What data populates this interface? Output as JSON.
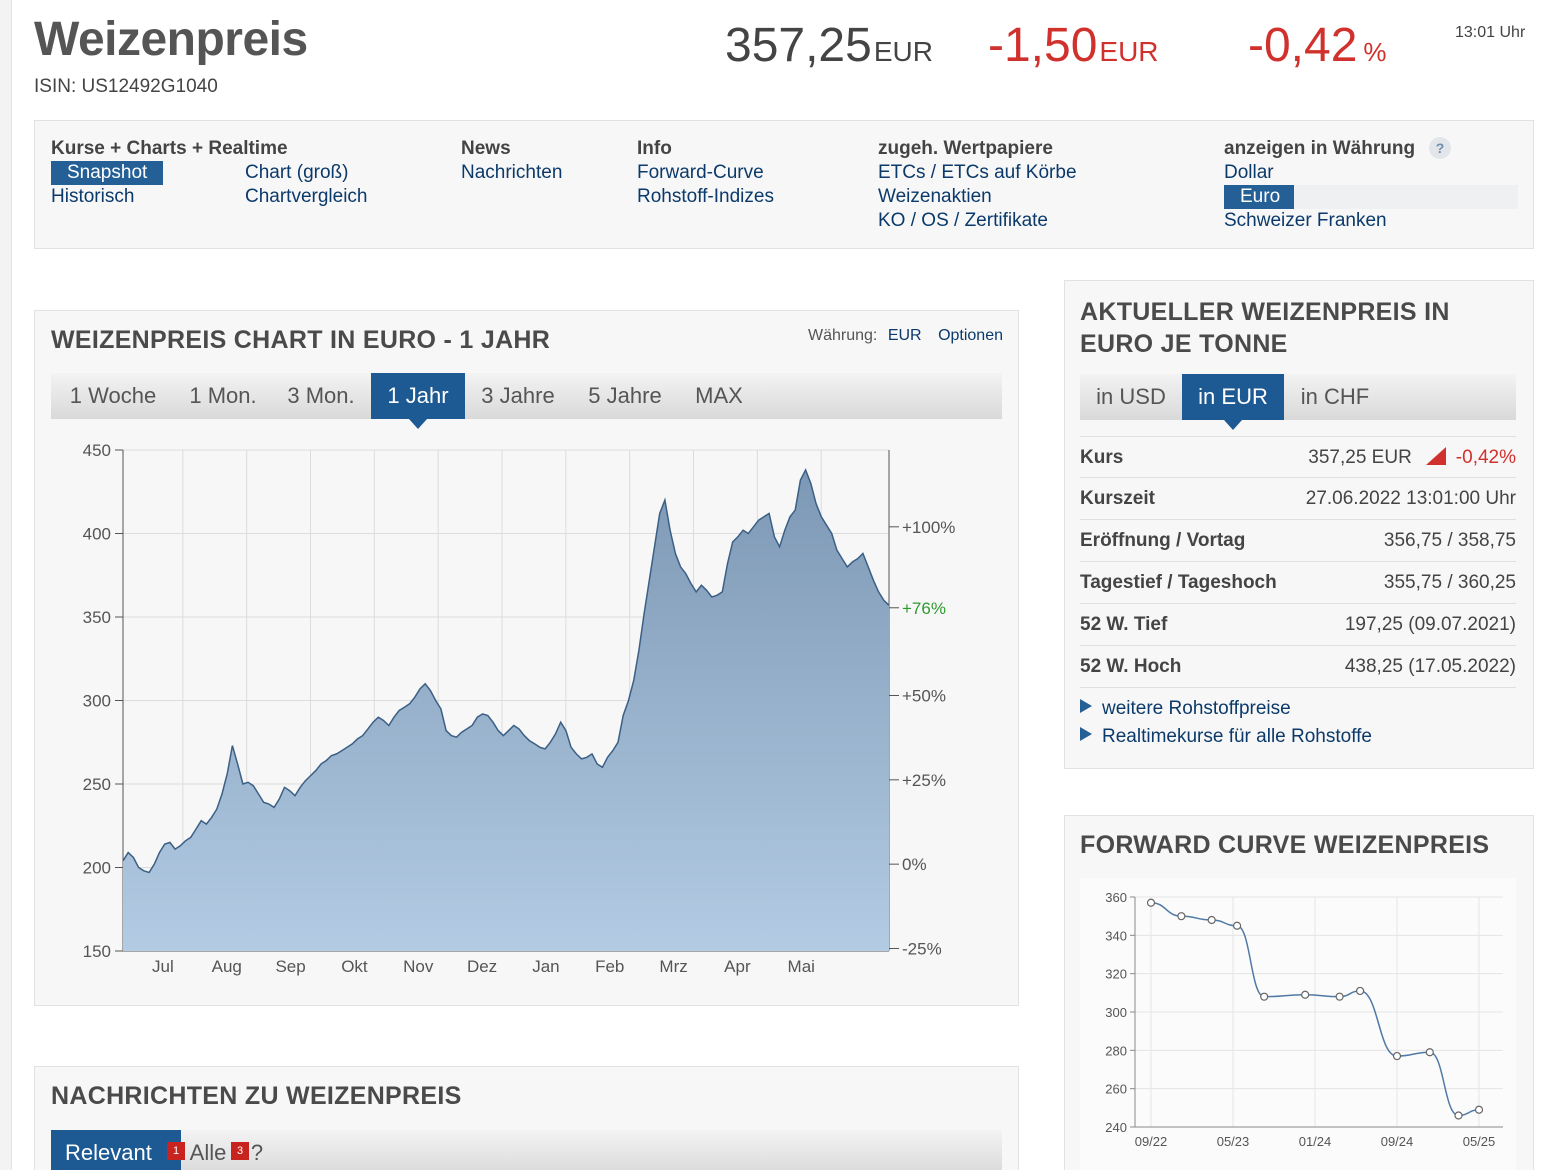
{
  "header": {
    "title": "Weizenpreis",
    "isin": "ISIN: US12492G1040",
    "price": "357,25",
    "price_unit": "EUR",
    "change": "-1,50",
    "change_unit": "EUR",
    "change_pct": "-0,42",
    "pct_unit": "%",
    "time": "13:01 Uhr"
  },
  "nav": {
    "col1": {
      "heading": "Kurse + Charts + Realtime",
      "items": [
        "Snapshot",
        "Historisch"
      ]
    },
    "col1b": {
      "items": [
        "Chart (groß)",
        "Chartvergleich"
      ]
    },
    "col2": {
      "heading": "News",
      "items": [
        "Nachrichten"
      ]
    },
    "col3": {
      "heading": "Info",
      "items": [
        "Forward-Curve",
        "Rohstoff-Indizes"
      ]
    },
    "col4": {
      "heading": "zugeh. Wertpapiere",
      "items": [
        "ETCs / ETCs auf Körbe",
        "Weizenaktien",
        "KO / OS / Zertifikate"
      ]
    },
    "col5": {
      "heading": "anzeigen in Währung",
      "help": "?",
      "items": [
        "Dollar",
        "Euro",
        "Schweizer Franken"
      ]
    }
  },
  "main_chart": {
    "title": "WEIZENPREIS CHART IN EURO - 1 JAHR",
    "currency_label": "Währung:",
    "currency_value": "EUR",
    "options_label": "Optionen",
    "tabs": [
      "1 Woche",
      "1 Mon.",
      "3 Mon.",
      "1 Jahr",
      "3 Jahre",
      "5 Jahre",
      "MAX"
    ],
    "active_tab": "1 Jahr"
  },
  "quote_panel": {
    "title_line1": "AKTUELLER WEIZENPREIS IN",
    "title_line2": "EURO JE TONNE",
    "tabs": [
      "in USD",
      "in EUR",
      "in CHF"
    ],
    "active_tab": "in EUR",
    "rows": [
      {
        "label": "Kurs",
        "value": "357,25 EUR",
        "extra": "-0,42%"
      },
      {
        "label": "Kurszeit",
        "value": "27.06.2022 13:01:00 Uhr"
      },
      {
        "label": "Eröffnung / Vortag",
        "value": "356,75 / 358,75"
      },
      {
        "label": "Tagestief / Tageshoch",
        "value": "355,75 / 360,25"
      },
      {
        "label": "52 W. Tief",
        "value": "197,25 (09.07.2021)"
      },
      {
        "label": "52 W. Hoch",
        "value": "438,25 (17.05.2022)"
      }
    ],
    "links": [
      "weitere Rohstoffpreise",
      "Realtimekurse für alle Rohstoffe"
    ]
  },
  "forward_panel": {
    "title": "FORWARD CURVE WEIZENPREIS"
  },
  "news_panel": {
    "title": "NACHRICHTEN ZU WEIZENPREIS",
    "tabs": [
      {
        "label": "Relevant",
        "count": "1"
      },
      {
        "label": "Alle",
        "count": "3"
      }
    ],
    "help": "?"
  },
  "colors": {
    "accent": "#1d5a94",
    "negative": "#d0312d",
    "positive": "#2e9a2e",
    "area_fill": "#8aa6c2",
    "line": "#3b5f85"
  },
  "chart_data": [
    {
      "type": "area",
      "x": [
        "Jul",
        "Aug",
        "Sep",
        "Okt",
        "Nov",
        "Dez",
        "Jan",
        "Feb",
        "Mrz",
        "Apr",
        "Mai"
      ],
      "y_ticks": [
        150,
        200,
        250,
        300,
        350,
        400,
        450
      ],
      "y_right_ticks": [
        "--25%",
        "-0%",
        "-+25%",
        "-+50%",
        "-+76%",
        "-+100%"
      ],
      "ylim": [
        150,
        450
      ],
      "current_pct_label": "+76%",
      "values": [
        204,
        209,
        206,
        200,
        198,
        197,
        202,
        209,
        214,
        215,
        211,
        213,
        216,
        218,
        223,
        228,
        226,
        230,
        235,
        244,
        256,
        273,
        262,
        250,
        251,
        249,
        244,
        239,
        238,
        236,
        241,
        248,
        246,
        243,
        248,
        252,
        255,
        258,
        262,
        264,
        267,
        268,
        270,
        272,
        274,
        277,
        279,
        283,
        287,
        290,
        288,
        285,
        290,
        294,
        296,
        298,
        302,
        307,
        310,
        306,
        300,
        295,
        282,
        279,
        278,
        281,
        283,
        285,
        290,
        292,
        291,
        287,
        282,
        279,
        282,
        285,
        283,
        279,
        276,
        274,
        272,
        271,
        275,
        280,
        287,
        282,
        272,
        268,
        265,
        266,
        268,
        262,
        260,
        266,
        270,
        275,
        291,
        300,
        312,
        330,
        352,
        372,
        392,
        412,
        420,
        402,
        388,
        380,
        376,
        370,
        365,
        369,
        366,
        362,
        363,
        365,
        382,
        395,
        398,
        402,
        400,
        404,
        408,
        410,
        412,
        398,
        392,
        402,
        410,
        414,
        432,
        438,
        430,
        418,
        410,
        405,
        400,
        390,
        385,
        380,
        383,
        385,
        388,
        380,
        372,
        365,
        360,
        357
      ],
      "xlabel": "",
      "ylabel": ""
    },
    {
      "type": "line",
      "x": [
        "09/22",
        "05/23",
        "01/24",
        "09/24",
        "05/25"
      ],
      "y_ticks": [
        240,
        260,
        280,
        300,
        320,
        340,
        360
      ],
      "ylim": [
        240,
        360
      ],
      "points": [
        {
          "x": 0,
          "y": 357
        },
        {
          "x": 0.37,
          "y": 350
        },
        {
          "x": 0.74,
          "y": 348
        },
        {
          "x": 1.05,
          "y": 345
        },
        {
          "x": 1.38,
          "y": 308
        },
        {
          "x": 1.88,
          "y": 309
        },
        {
          "x": 2.3,
          "y": 308
        },
        {
          "x": 2.55,
          "y": 311
        },
        {
          "x": 3.0,
          "y": 277
        },
        {
          "x": 3.4,
          "y": 279
        },
        {
          "x": 3.75,
          "y": 246
        },
        {
          "x": 4.0,
          "y": 249
        }
      ],
      "xlabel": "",
      "ylabel": ""
    }
  ]
}
